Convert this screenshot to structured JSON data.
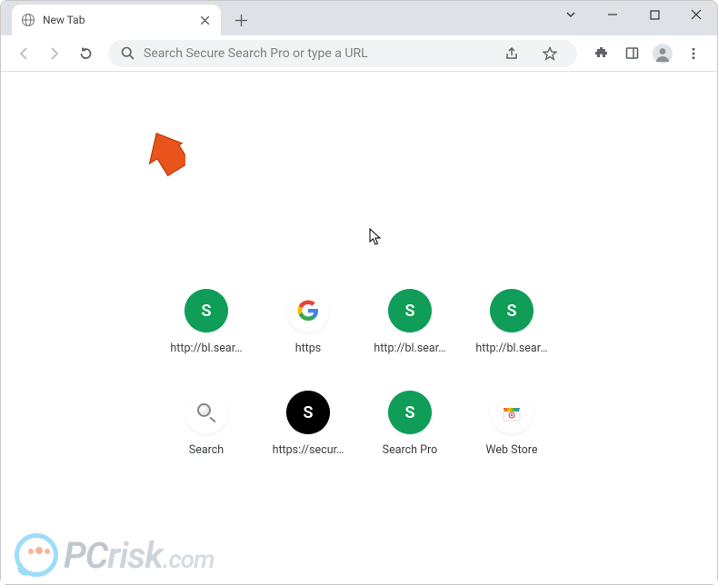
{
  "tab": {
    "title": "New Tab"
  },
  "omnibox": {
    "placeholder": "Search Secure Search Pro or type a URL"
  },
  "shortcuts": [
    {
      "icon": "green-s",
      "label": "http://bl.sear…"
    },
    {
      "icon": "google",
      "label": "https"
    },
    {
      "icon": "green-s",
      "label": "http://bl.sear…"
    },
    {
      "icon": "green-s",
      "label": "http://bl.sear…"
    },
    {
      "icon": "magnifier",
      "label": "Search"
    },
    {
      "icon": "black-s",
      "label": "https://secur…"
    },
    {
      "icon": "green-s",
      "label": "Search Pro"
    },
    {
      "icon": "webstore",
      "label": "Web Store"
    }
  ],
  "watermark": {
    "pc": "PC",
    "risk": "risk",
    "com": ".com"
  }
}
